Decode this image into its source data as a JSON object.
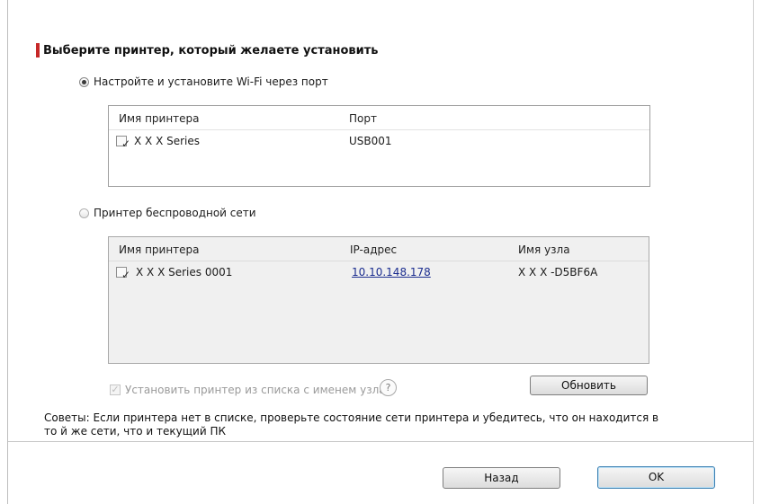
{
  "dialog": {
    "heading": "Выберите принтер, который желаете установить"
  },
  "wifi_option": {
    "label": "Настройте и установите Wi-Fi через порт",
    "selected": true,
    "columns": [
      "Имя принтера",
      "Порт"
    ],
    "rows": [
      {
        "checked": true,
        "name": "X X X  Series",
        "port": "USB001"
      }
    ]
  },
  "wireless_option": {
    "label": "Принтер беспроводной сети",
    "selected": false,
    "columns": [
      "Имя принтера",
      "IP-адрес",
      "Имя узла"
    ],
    "rows": [
      {
        "checked": true,
        "name": "X X X  Series 0001",
        "ip": "10.10.148.178",
        "host": "X X X -D5BF6A"
      }
    ],
    "hostname_checkbox_label": "Установить принтер из списка с именем узла",
    "hostname_checkbox_checked": true,
    "hostname_checkbox_enabled": false,
    "help_icon": "?",
    "refresh_label": "Обновить"
  },
  "tips": "Советы: Если принтера нет в списке, проверьте состояние сети принтера и убедитесь, что он находится в то й же сети, что и текущий ПК",
  "buttons": {
    "back_label": "Назад",
    "ok_label": "OK"
  },
  "icons": {
    "checkmark": "✓",
    "radio_checked": "radio-checked-icon",
    "help": "question-mark-icon"
  },
  "colors": {
    "heading_marker": "#c62828",
    "link": "#1b2d8f"
  }
}
